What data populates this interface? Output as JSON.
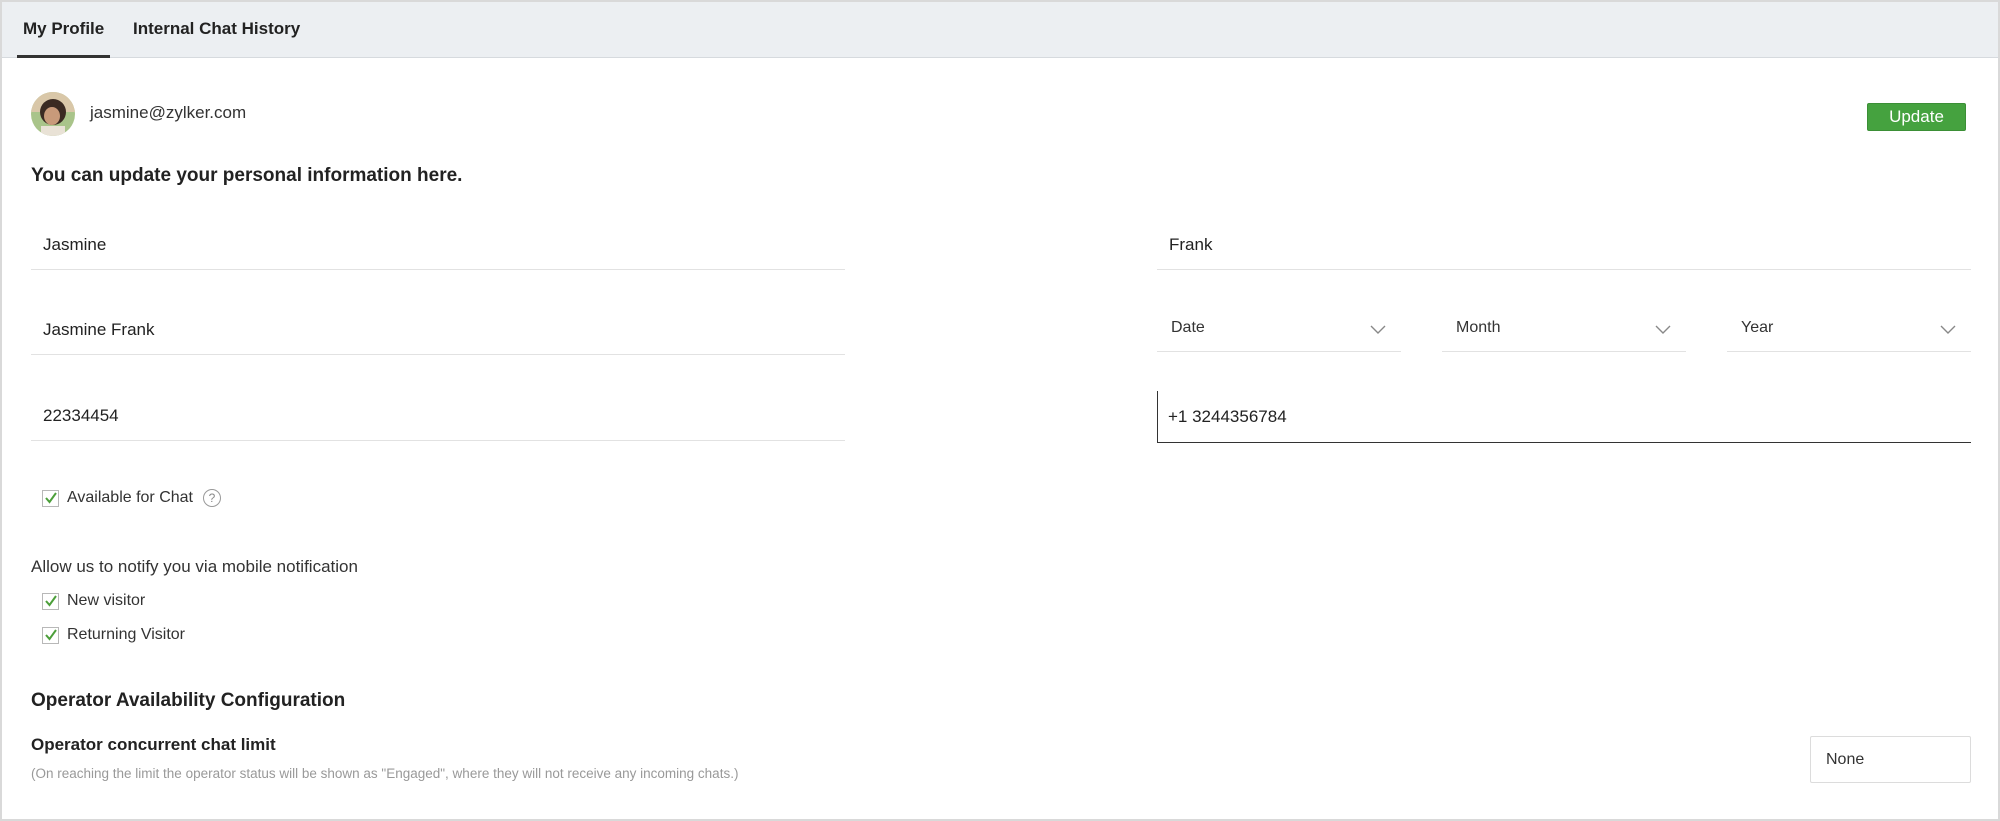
{
  "tabs": [
    {
      "label": "My Profile",
      "active": true
    },
    {
      "label": "Internal Chat History",
      "active": false
    }
  ],
  "profile": {
    "email": "jasmine@zylker.com",
    "update_label": "Update",
    "intro": "You can update your personal information here."
  },
  "fields": {
    "first_name": "Jasmine",
    "last_name": "Frank",
    "display_name": "Jasmine Frank",
    "employee_id": "22334454",
    "phone": "+1 3244356784"
  },
  "dob": {
    "date": "Date",
    "month": "Month",
    "year": "Year"
  },
  "availability": {
    "label": "Available for Chat",
    "checked": true,
    "help_glyph": "?"
  },
  "notifications": {
    "title": "Allow us to notify you via mobile notification",
    "new_visitor": "New visitor",
    "returning_visitor": "Returning Visitor"
  },
  "operator": {
    "title": "Operator Availability Configuration",
    "limit_label": "Operator concurrent chat limit",
    "limit_note": "(On reaching the limit the operator status will be shown as \"Engaged\", where they will not receive any incoming chats.)",
    "limit_value": "None"
  },
  "colors": {
    "accent_green": "#45a23f",
    "tabbar_bg": "#eceff2"
  }
}
